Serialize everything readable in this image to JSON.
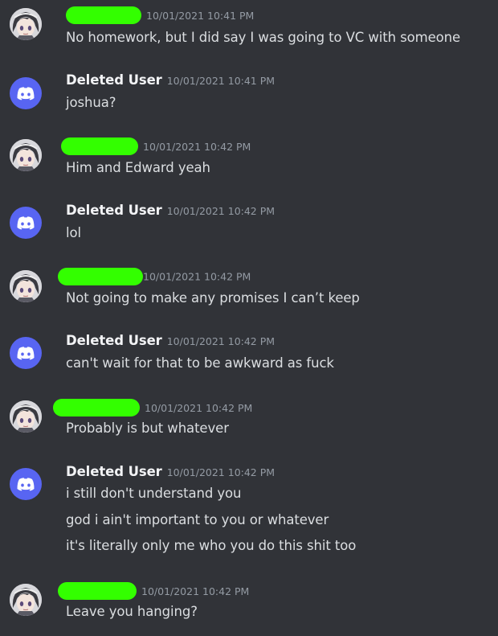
{
  "colors": {
    "background": "#313338",
    "discord_blurple": "#5865f2",
    "redaction_green": "#33ff00",
    "username": "#f2f3f5",
    "timestamp": "#949ba4",
    "message_text": "#dbdee1"
  },
  "messages": [
    {
      "author": "",
      "author_redacted": true,
      "avatar": "anime-avatar",
      "timestamp": "10/01/2021 10:41 PM",
      "lines": [
        "No homework, but I did say I was going to VC with someone"
      ]
    },
    {
      "author": "Deleted User",
      "avatar": "discord-logo-icon",
      "timestamp": "10/01/2021 10:41 PM",
      "lines": [
        "joshua?"
      ]
    },
    {
      "author": "",
      "author_redacted": true,
      "avatar": "anime-avatar",
      "timestamp": "10/01/2021 10:42 PM",
      "lines": [
        "Him and Edward yeah"
      ]
    },
    {
      "author": "Deleted User",
      "avatar": "discord-logo-icon",
      "timestamp": "10/01/2021 10:42 PM",
      "lines": [
        "lol"
      ]
    },
    {
      "author": "",
      "author_redacted": true,
      "avatar": "anime-avatar",
      "timestamp": "10/01/2021 10:42 PM",
      "lines": [
        "Not going to make any promises I can’t keep"
      ]
    },
    {
      "author": "Deleted User",
      "avatar": "discord-logo-icon",
      "timestamp": "10/01/2021 10:42 PM",
      "lines": [
        "can't wait for that to be awkward as fuck"
      ]
    },
    {
      "author": "",
      "author_redacted": true,
      "avatar": "anime-avatar",
      "timestamp": "10/01/2021 10:42 PM",
      "lines": [
        "Probably is but whatever"
      ]
    },
    {
      "author": "Deleted User",
      "avatar": "discord-logo-icon",
      "timestamp": "10/01/2021 10:42 PM",
      "lines": [
        "i still don't understand you",
        "god i ain't important to you or whatever",
        "it's literally only me who you do this shit too"
      ]
    },
    {
      "author": "",
      "author_redacted": true,
      "avatar": "anime-avatar",
      "timestamp": "10/01/2021 10:42 PM",
      "lines": [
        "Leave you hanging?"
      ]
    }
  ]
}
